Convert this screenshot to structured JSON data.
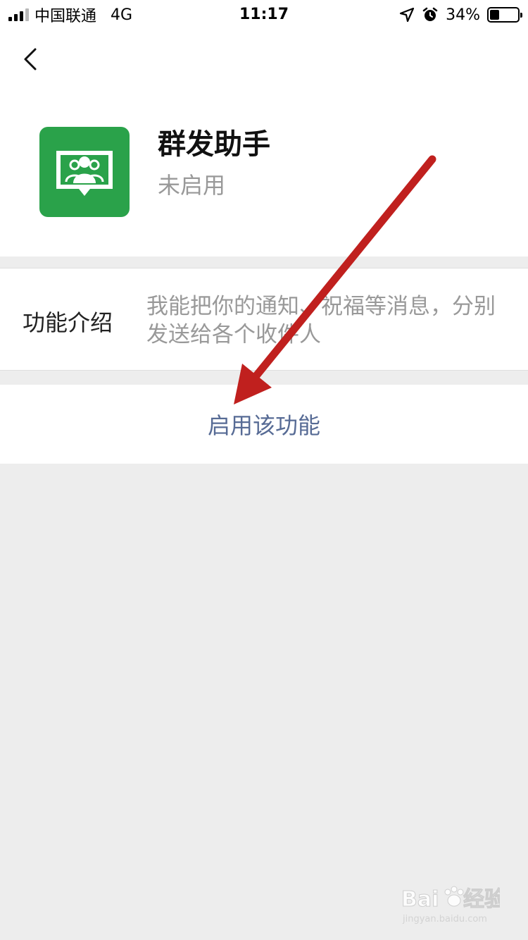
{
  "status_bar": {
    "carrier": "中国联通",
    "network": "4G",
    "time": "11:17",
    "battery_percent": "34%",
    "battery_level": 0.34,
    "icons": [
      "signal-icon",
      "location-arrow-icon",
      "alarm-clock-icon",
      "battery-icon"
    ]
  },
  "nav": {
    "back_icon": "chevron-left-icon"
  },
  "app": {
    "name": "群发助手",
    "status": "未启用",
    "icon": "group-message-icon",
    "icon_color": "#2aa24a"
  },
  "intro": {
    "label": "功能介绍",
    "description": "我能把你的通知、祝福等消息，分别发送给各个收件人"
  },
  "action": {
    "label": "启用该功能",
    "color": "#576b95"
  },
  "annotation": {
    "arrow_color": "#c0201e"
  },
  "watermark": {
    "brand": "Bai",
    "suffix": "经验",
    "url": "jingyan.baidu.com"
  }
}
